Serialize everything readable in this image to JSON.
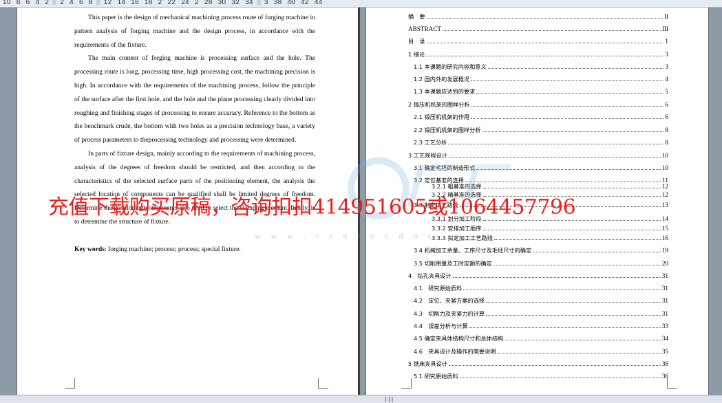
{
  "ruler": {
    "labels": [
      "10",
      "8",
      "6",
      "4",
      "2",
      "2",
      "4",
      "6",
      "8",
      "12",
      "14",
      "16",
      "18",
      "2",
      "22",
      "24",
      "2",
      "28",
      "30",
      "32",
      "34",
      "3",
      "38",
      "40",
      "42",
      "44"
    ]
  },
  "abstract": {
    "paragraphs": [
      "This paper is the design of mechanical machining process route of forging machine in pattern analysis of forging machine and the design process, in accordance with the requirements of the fixture.",
      "The main content of forging machine is processing surface and the hole. The processing route is long, processing time, high processing cost, the machining precision is high. In accordance with the requirements of the machining process, follow the principle of the surface after the first hole, and the hole and the plane processing clearly divided into roughing and finishing stages of processing to ensure accuracy. Reference to the bottom as the benchmark crude, the bottom with two holes as a precision technology base, a variety of process parameters to theprocessing technology and processing were determined.",
      "In parts of fixture design, mainly according to the requirements of machining process, analysis of the degrees of freedom should be restricted, and then according to the characteristics of the selected surface parts of the positioning element, the analysis the selected location of components can be qualified shall be limited degrees of freedom. Determine the positioning components also need to select the clamping element, finally, is to determine the structure of fixture."
    ],
    "keywords_label": "Key words",
    "keywords_text": ": forging machine; process; process; special fixture."
  },
  "toc": [
    {
      "label": "摘　要",
      "page": "II"
    },
    {
      "label": "ABSTRACT",
      "page": "III"
    },
    {
      "label": "目　录",
      "page": "1"
    },
    {
      "label": "1 绪论",
      "page": "3"
    },
    {
      "label": "1.1 本课题的研究内容和意义",
      "page": "3"
    },
    {
      "label": "1.2 国内外的发展概况",
      "page": "4"
    },
    {
      "label": "1.3 本课题应达到的要求",
      "page": "5"
    },
    {
      "label": "2 锻压机机架的图样分析",
      "page": "6"
    },
    {
      "label": "2.1 锻压机机架的作用",
      "page": "6"
    },
    {
      "label": "2.2 锻压机机架的图样分析",
      "page": "8"
    },
    {
      "label": "2.3 工艺分析",
      "page": "8"
    },
    {
      "label": "3 工艺规程设计",
      "page": "10"
    },
    {
      "label": "3.1 确定毛坯的制造形式",
      "page": "10"
    },
    {
      "label": "3.2 定位基准的选择",
      "page": "11"
    },
    {
      "label": "3.2.1 粗基准的选择",
      "page": "12"
    },
    {
      "label": "3.2.2 精基准的选择",
      "page": "12"
    },
    {
      "label": "3.3 制定工艺路线",
      "page": "13"
    },
    {
      "label": "3.3.1 划分加工阶段",
      "page": "14"
    },
    {
      "label": "3.3.2 安排加工顺序",
      "page": "15"
    },
    {
      "label": "3.3.3 拟定加工工艺路线",
      "page": "16"
    },
    {
      "label": "3.4 机械加工余量、工序尺寸及毛坯尺寸的确定",
      "page": "19"
    },
    {
      "label": "3.5 切削用量及工时定额的确定",
      "page": "20"
    },
    {
      "label": "4　钻孔夹具设计",
      "page": "31"
    },
    {
      "label": "4.1　研究原始质料",
      "page": "31"
    },
    {
      "label": "4.2　定位、夹紧方案的选择",
      "page": "31"
    },
    {
      "label": "4.3　切削力及夹紧力的计算",
      "page": "31"
    },
    {
      "label": "4.4　误差分析与计算",
      "page": "33"
    },
    {
      "label": "4.5 确定夹具体结构尺寸和总体结构",
      "page": "34"
    },
    {
      "label": "4.6　夹具设计及操作的简要说明",
      "page": "35"
    },
    {
      "label": "5 铣床夹具设计",
      "page": "36"
    },
    {
      "label": "5.1 研究原始质料",
      "page": "36"
    }
  ],
  "watermark": {
    "overlay_text": "充值下载购买原稿，咨询扣扣414951605或1064457796",
    "url_text": "w w w . r e n r e n d o c . c o m"
  },
  "colors": {
    "overlay": "#ee1c1c",
    "workspace": "#8e9aa6"
  }
}
